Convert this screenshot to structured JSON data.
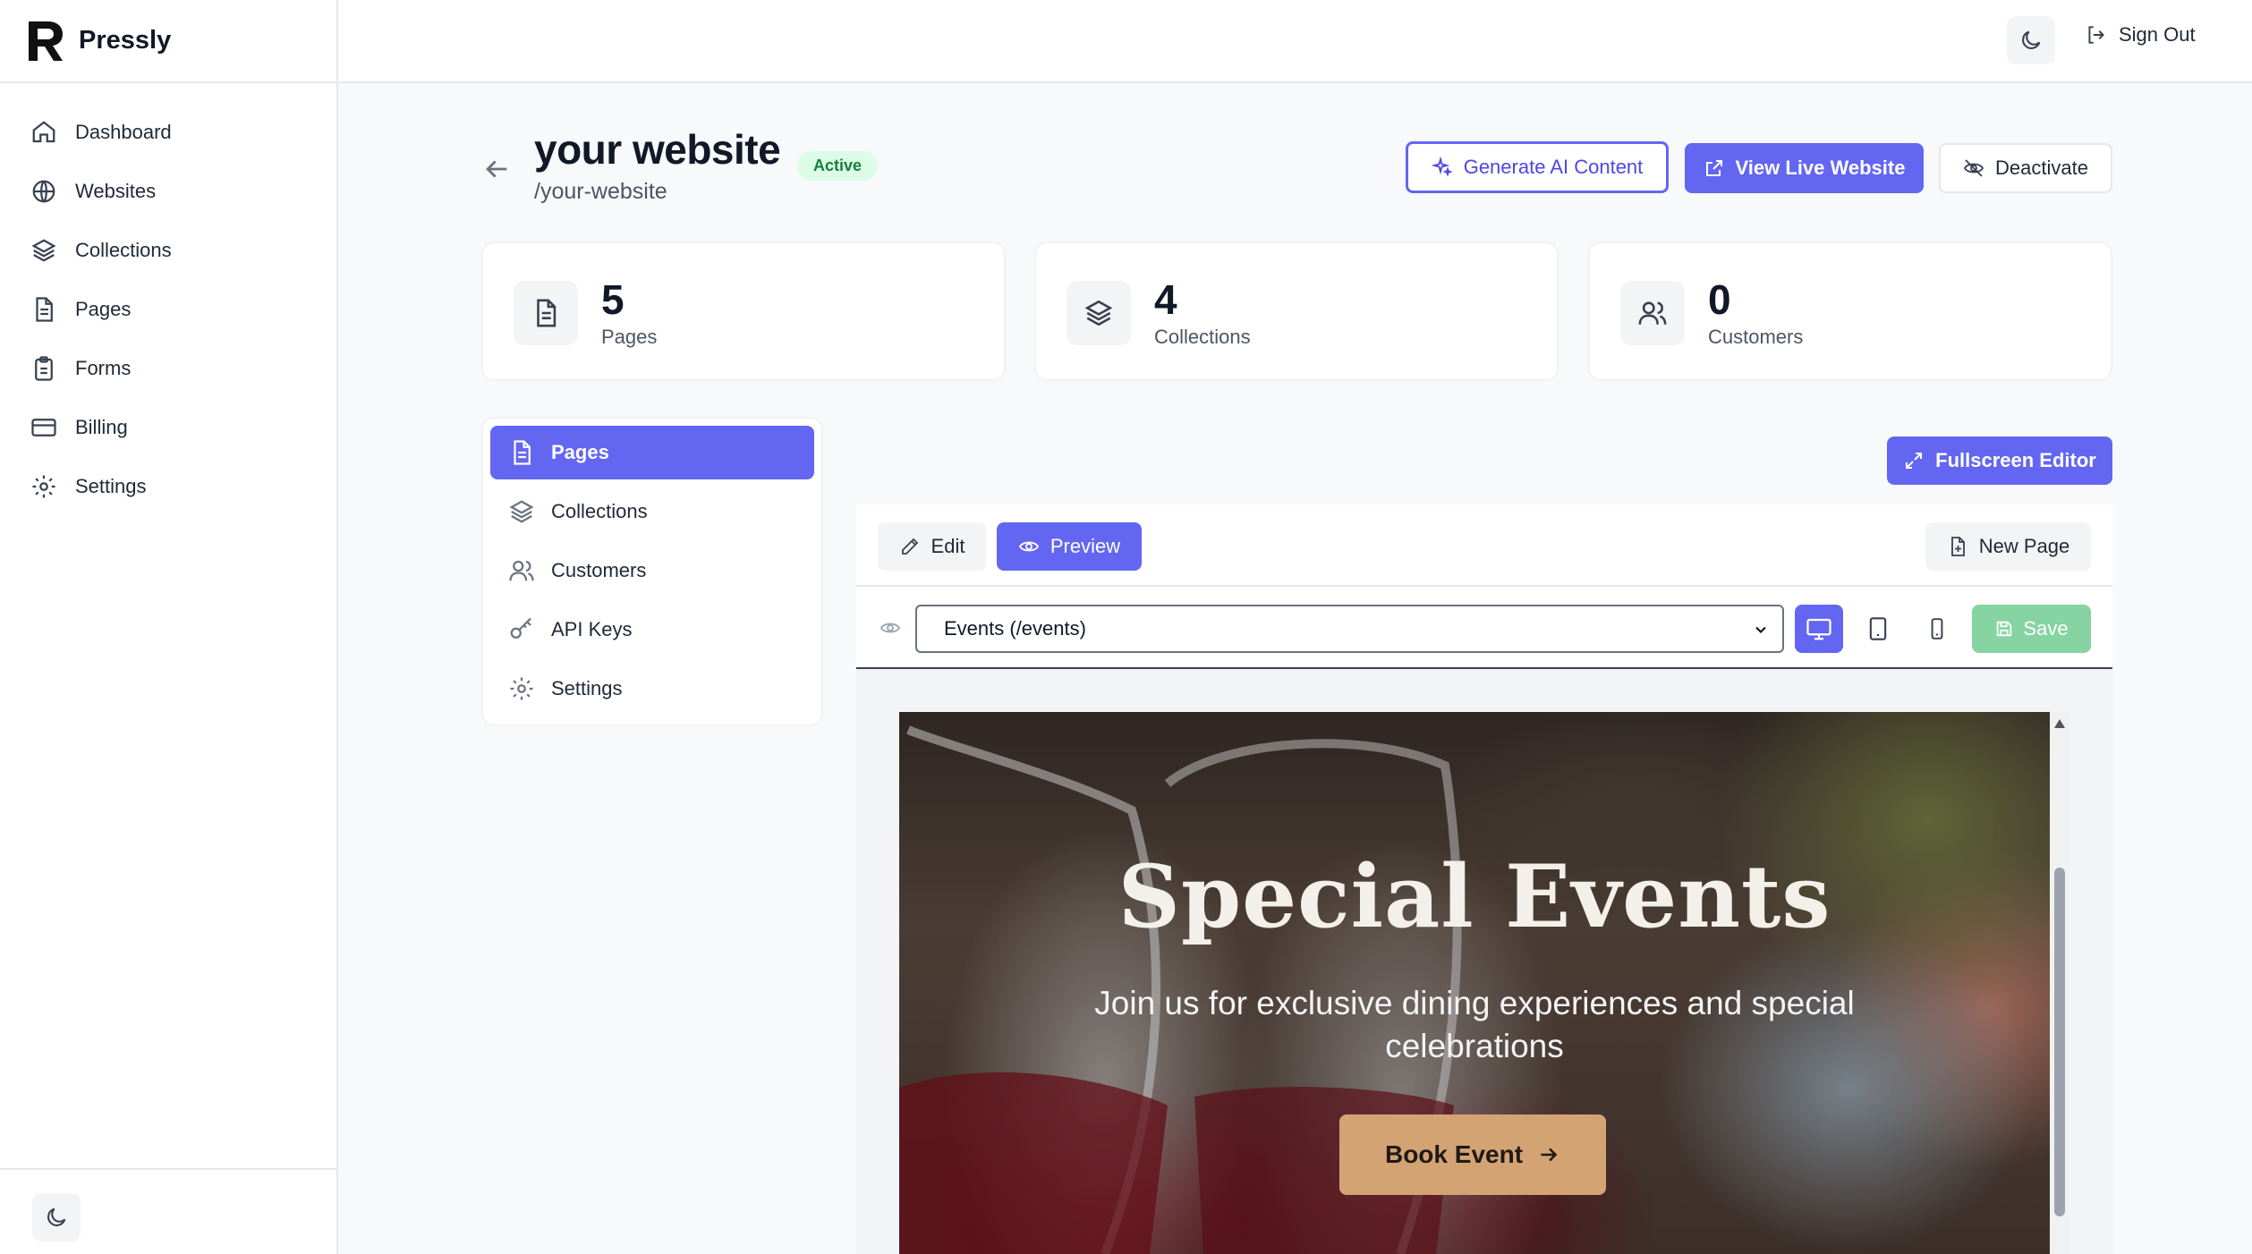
{
  "brand": {
    "name": "Pressly"
  },
  "sidebar": {
    "items": [
      {
        "label": "Dashboard",
        "icon": "home-icon"
      },
      {
        "label": "Websites",
        "icon": "globe-icon"
      },
      {
        "label": "Collections",
        "icon": "layers-icon"
      },
      {
        "label": "Pages",
        "icon": "file-icon"
      },
      {
        "label": "Forms",
        "icon": "clipboard-icon"
      },
      {
        "label": "Billing",
        "icon": "credit-card-icon"
      },
      {
        "label": "Settings",
        "icon": "gear-icon"
      }
    ]
  },
  "topbar": {
    "signout_label": "Sign Out"
  },
  "header": {
    "title": "your website",
    "slug": "/your-website",
    "status": "Active",
    "generate_label": "Generate AI Content",
    "view_label": "View Live Website",
    "deactivate_label": "Deactivate"
  },
  "stats": [
    {
      "value": "5",
      "label": "Pages"
    },
    {
      "value": "4",
      "label": "Collections"
    },
    {
      "value": "0",
      "label": "Customers"
    }
  ],
  "subnav": {
    "items": [
      {
        "label": "Pages",
        "active": true
      },
      {
        "label": "Collections"
      },
      {
        "label": "Customers"
      },
      {
        "label": "API Keys"
      },
      {
        "label": "Settings"
      }
    ]
  },
  "editor": {
    "fullscreen_label": "Fullscreen Editor",
    "edit_label": "Edit",
    "preview_label": "Preview",
    "new_page_label": "New Page",
    "selected_page": "Events (/events)",
    "save_label": "Save"
  },
  "preview": {
    "title": "Special Events",
    "subtitle": "Join us for exclusive dining experiences and special celebrations",
    "cta_label": "Book Event"
  },
  "colors": {
    "accent": "#6366f1",
    "active_badge_bg": "#dcfce7",
    "active_badge_text": "#15803d",
    "save_disabled": "#86d4a2",
    "cta": "#d4a373"
  }
}
